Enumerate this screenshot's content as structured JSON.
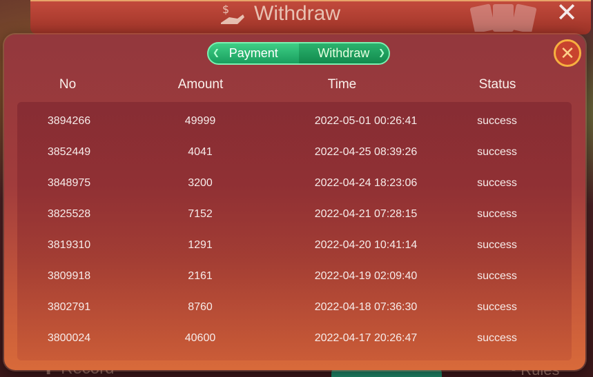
{
  "background": {
    "title": "Withdraw",
    "bottom_left_label": "Record",
    "bottom_right_label": "Rules"
  },
  "tabs": [
    {
      "label": "Payment",
      "active": false
    },
    {
      "label": "Withdraw",
      "active": true
    }
  ],
  "columns": [
    "No",
    "Amount",
    "Time",
    "Status"
  ],
  "rows": [
    {
      "no": "3894266",
      "amount": "49999",
      "time": "2022-05-01 00:26:41",
      "status": "success"
    },
    {
      "no": "3852449",
      "amount": "4041",
      "time": "2022-04-25 08:39:26",
      "status": "success"
    },
    {
      "no": "3848975",
      "amount": "3200",
      "time": "2022-04-24 18:23:06",
      "status": "success"
    },
    {
      "no": "3825528",
      "amount": "7152",
      "time": "2022-04-21 07:28:15",
      "status": "success"
    },
    {
      "no": "3819310",
      "amount": "1291",
      "time": "2022-04-20 10:41:14",
      "status": "success"
    },
    {
      "no": "3809918",
      "amount": "2161",
      "time": "2022-04-19 02:09:40",
      "status": "success"
    },
    {
      "no": "3802791",
      "amount": "8760",
      "time": "2022-04-18 07:36:30",
      "status": "success"
    },
    {
      "no": "3800024",
      "amount": "40600",
      "time": "2022-04-17 20:26:47",
      "status": "success"
    }
  ],
  "colors": {
    "dialog_top": "#93383d",
    "dialog_bottom": "#d86a3a",
    "tab_green": "#2bb36e",
    "close_ring": "#f7b040"
  },
  "icons": {
    "close": "close-circle-icon",
    "background_close": "close-x-icon",
    "title_icon": "money-hand-icon"
  }
}
